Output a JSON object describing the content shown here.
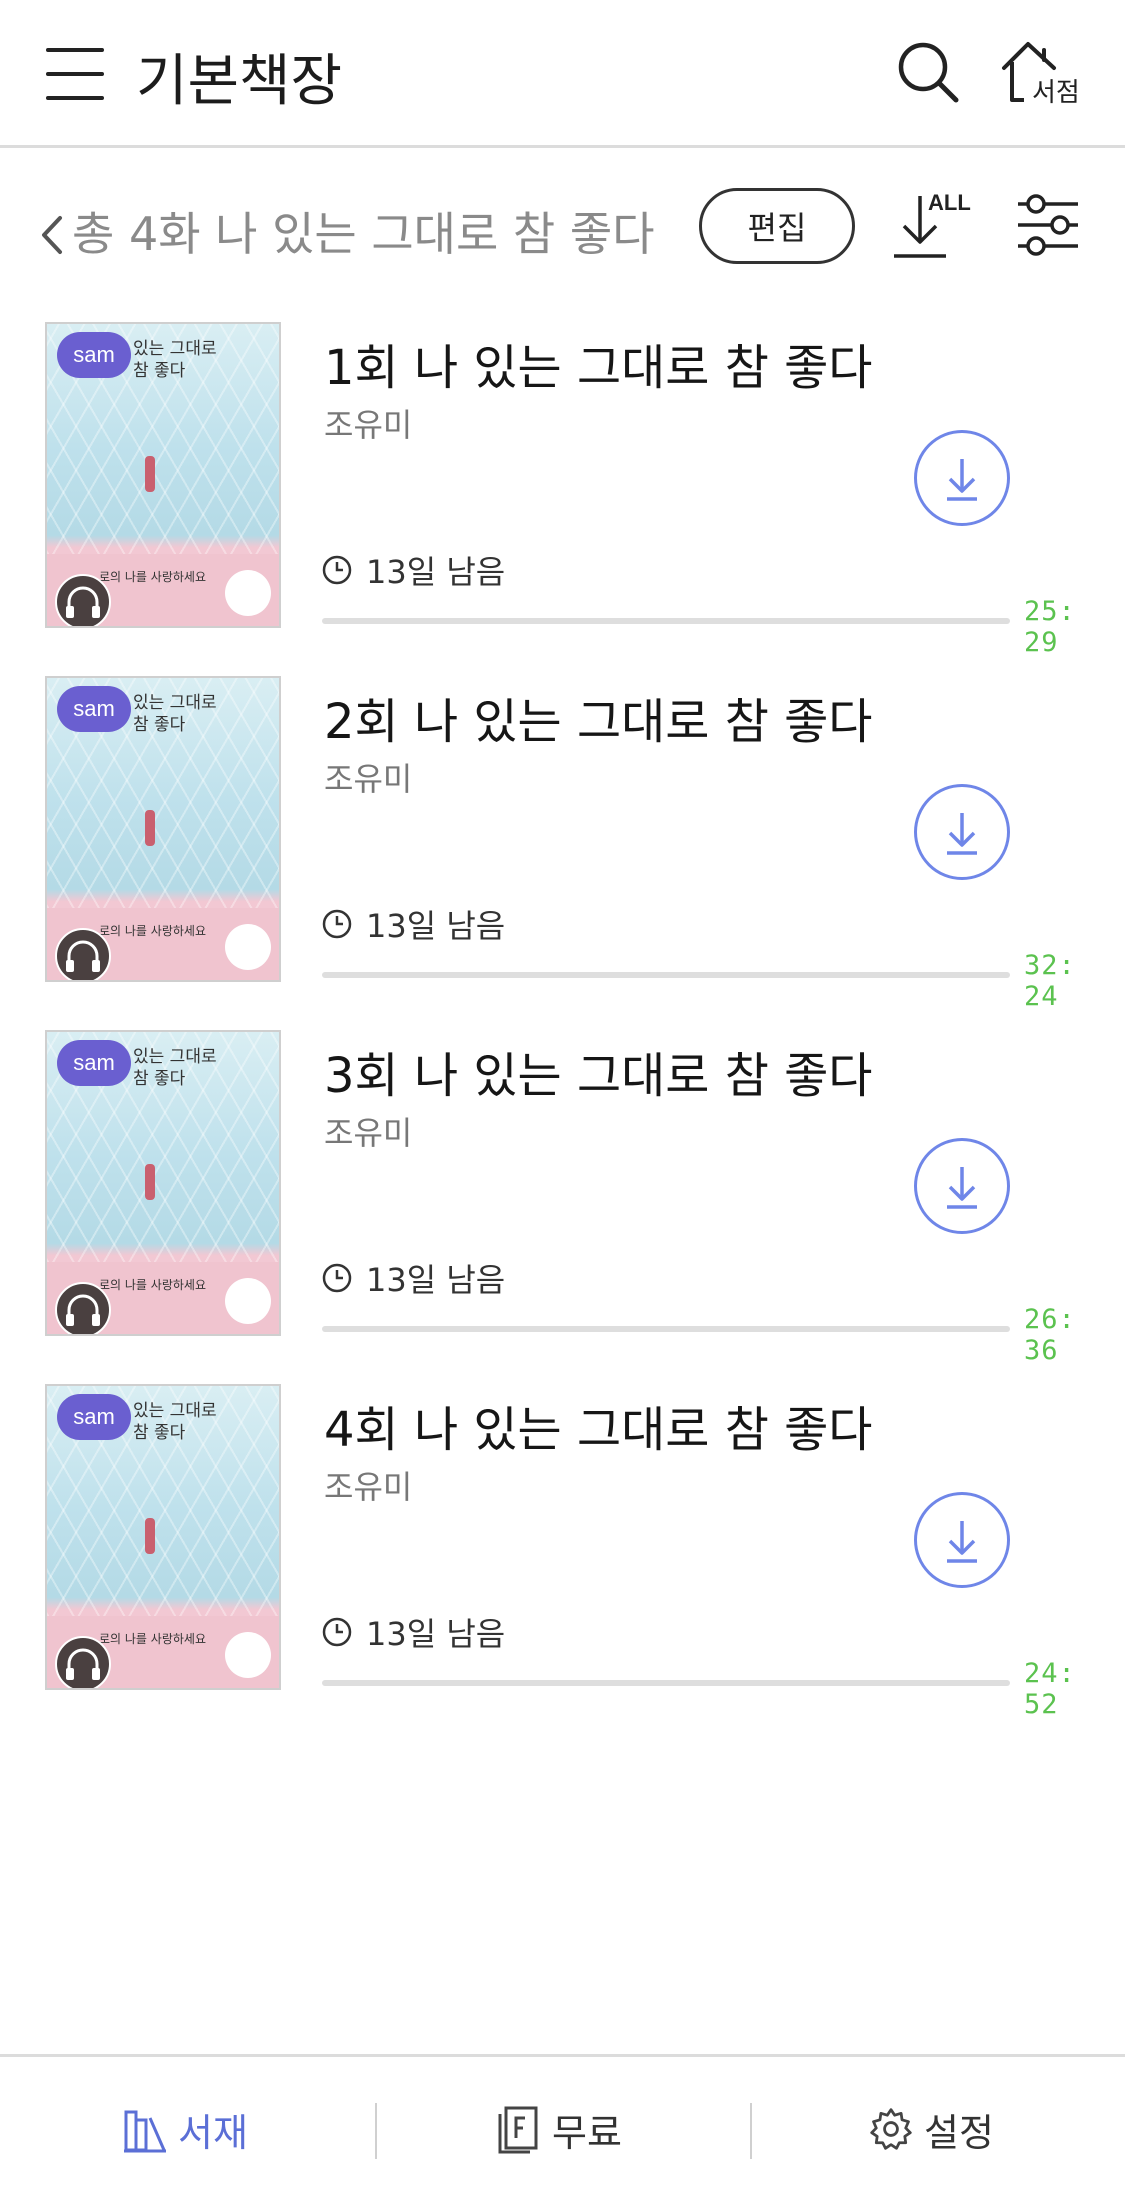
{
  "header": {
    "title": "기본책장",
    "store_label": "서점",
    "menu_icon": "menu-icon",
    "search_icon": "search-icon",
    "store_icon": "home-icon"
  },
  "subheader": {
    "title": "총 4화 나 있는 그대로 참 좋다",
    "edit_label": "편집",
    "download_all_label": "ALL",
    "filter_icon": "sliders-icon"
  },
  "cover": {
    "badge": "sam",
    "title": "있는 그대로 참 좋다",
    "quote": "로의 나를 사랑하세요"
  },
  "episodes": [
    {
      "title": "1회 나 있는 그대로 참 좋다",
      "author": "조유미",
      "remaining": "13일 남음",
      "duration": "25: 29",
      "progress": 0
    },
    {
      "title": "2회 나 있는 그대로 참 좋다",
      "author": "조유미",
      "remaining": "13일 남음",
      "duration": "32: 24",
      "progress": 0
    },
    {
      "title": "3회 나 있는 그대로 참 좋다",
      "author": "조유미",
      "remaining": "13일 남음",
      "duration": "26: 36",
      "progress": 0
    },
    {
      "title": "4회 나 있는 그대로 참 좋다",
      "author": "조유미",
      "remaining": "13일 남음",
      "duration": "24: 52",
      "progress": 0
    }
  ],
  "tabbar": {
    "tabs": [
      {
        "label": "서재",
        "icon": "bookshelf-icon",
        "active": true
      },
      {
        "label": "무료",
        "icon": "free-book-icon",
        "active": false
      },
      {
        "label": "설정",
        "icon": "gear-icon",
        "active": false
      }
    ]
  },
  "colors": {
    "accent": "#5b6fd6",
    "download_circle": "#6f86e8",
    "duration_text": "#5bc24f",
    "sam_badge": "#6a5fd0"
  }
}
